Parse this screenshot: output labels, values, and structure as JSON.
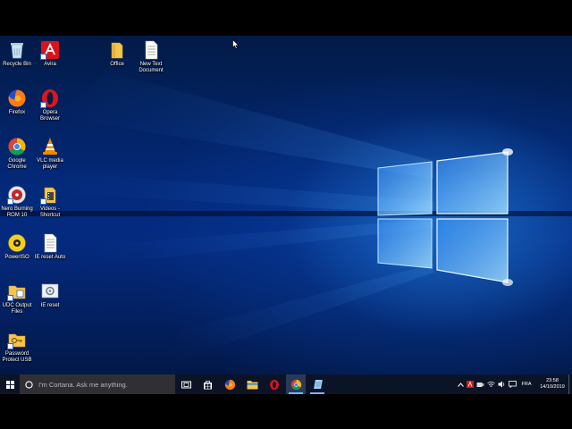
{
  "desktop": {
    "icons": [
      {
        "name": "recycle-bin",
        "label": "Recycle Bin"
      },
      {
        "name": "avira",
        "label": "Avira"
      },
      {
        "name": "office",
        "label": "Office"
      },
      {
        "name": "new-text-document",
        "label": "New Text Document"
      },
      {
        "name": "firefox",
        "label": "Firefox"
      },
      {
        "name": "opera",
        "label": "Opera Browser"
      },
      {
        "name": "google-chrome",
        "label": "Google Chrome"
      },
      {
        "name": "vlc",
        "label": "VLC media player"
      },
      {
        "name": "nero",
        "label": "Nero Burning ROM 10"
      },
      {
        "name": "videos-shortcut",
        "label": "Videos - Shortcut"
      },
      {
        "name": "poweriso",
        "label": "PowerISO"
      },
      {
        "name": "ie-reset-auto",
        "label": "IE reset Auto"
      },
      {
        "name": "udc-output-files",
        "label": "UDC Output Files"
      },
      {
        "name": "ie-reset",
        "label": "IE reset"
      },
      {
        "name": "password-protect-usb",
        "label": "Password Protect USB"
      }
    ]
  },
  "taskbar": {
    "search_placeholder": "I'm Cortana. Ask me anything.",
    "language": "FRA",
    "time": "23:58",
    "date": "14/10/2019"
  },
  "colors": {
    "taskbar_bg": "#0b1426",
    "search_bg": "#2f2f34",
    "desktop_blue": "#03297a",
    "active_indicator": "#7fb1ff"
  }
}
